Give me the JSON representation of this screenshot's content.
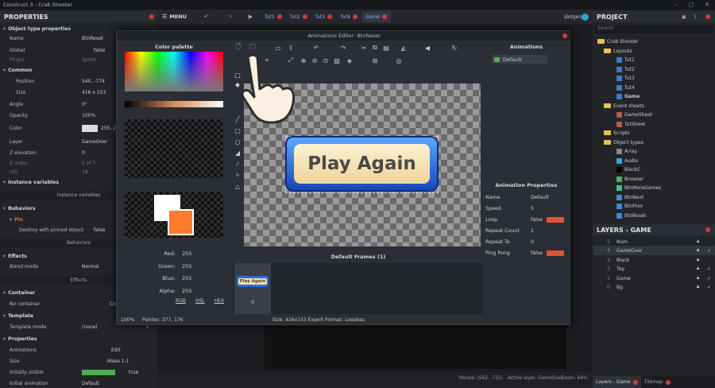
{
  "app": {
    "title": "Construct 3 - Crab Shooter"
  },
  "properties": {
    "title": "PROPERTIES",
    "sections": {
      "object_type": "Object type properties",
      "common": "Common",
      "instance_vars": "Instance variables",
      "behaviors": "Behaviors",
      "pin": "Pin",
      "effects": "Effects",
      "container": "Container",
      "template": "Template",
      "props": "Properties"
    },
    "rows": {
      "name_k": "Name",
      "name_v": "BtnReset",
      "global_k": "Global",
      "global_v": "false",
      "plugin_k": "Plugin",
      "plugin_v": "Sprite",
      "pos_k": "Position",
      "pos_v": "540, -774",
      "size_k": "Size",
      "size_v": "416 x 153",
      "angle_k": "Angle",
      "angle_v": "0°",
      "opacity_k": "Opacity",
      "opacity_v": "100%",
      "color_k": "Color",
      "color_v": "255, 2",
      "layer_k": "Layer",
      "layer_v": "GameOver",
      "zel_k": "Z elevation",
      "zel_v": "0",
      "zidx_k": "Z index",
      "zidx_v": "1 of 7",
      "uid_k": "UID",
      "uid_v": "18",
      "pin_k": "Destroy with pinned object",
      "pin_v": "false",
      "blend_k": "Blend mode",
      "blend_v": "Normal",
      "cont_k": "No container",
      "cont_v": "Cre",
      "tmpl_k": "Template mode",
      "tmpl_v": "(none)",
      "anim_k": "Animations",
      "anim_v": "Edit",
      "size2_k": "Size",
      "size2_v": "Make 1:1",
      "vis_k": "Initially visible",
      "vis_v": "true",
      "ianim_k": "Initial animation",
      "ianim_v": "Default"
    },
    "buttons": {
      "instance_vars": "Instance variables",
      "behaviors": "Behaviors",
      "effects": "Effects"
    }
  },
  "menu": {
    "label": "MENU",
    "tabs": [
      "Tut1",
      "Tut2",
      "Tut3",
      "Tut4",
      "Game"
    ],
    "user": "slotgen"
  },
  "project": {
    "title": "PROJECT",
    "search_placeholder": "Search",
    "items": [
      "Crab Shooter",
      "Layouts",
      "Tut1",
      "Tut2",
      "Tut3",
      "Tut4",
      "Game",
      "Event sheets",
      "GameSheet",
      "TutSheet",
      "Scripts",
      "Object types",
      "Array",
      "Audio",
      "BlackC",
      "Browser",
      "BtnMoreGames",
      "BtnNext",
      "BtnPrev",
      "BtnReset"
    ]
  },
  "layers": {
    "title": "LAYERS - GAME",
    "rows": [
      {
        "n": "5",
        "name": "Num"
      },
      {
        "n": "4",
        "name": "GameOver"
      },
      {
        "n": "3",
        "name": "Black"
      },
      {
        "n": "2",
        "name": "Top"
      },
      {
        "n": "1",
        "name": "Game"
      },
      {
        "n": "0",
        "name": "Bg"
      }
    ],
    "tab1": "Layers - Game",
    "tab2": "Tilemap"
  },
  "dialog": {
    "title": "Animations Editor: BtnReset",
    "palette_title": "Color palette",
    "animations_title": "Animations",
    "anim_item": "Default",
    "frames_title": "Default Frames (1)",
    "frame_index": "0",
    "zoom": "100%",
    "pointer": "Pointer: 377, 176",
    "size_info": "Size: 416x153   Export Format: Lossless",
    "button_text": "Play Again",
    "rgb": {
      "red_k": "Red:",
      "red_v": "255",
      "green_k": "Green:",
      "green_v": "255",
      "blue_k": "Blue:",
      "blue_v": "255",
      "alpha_k": "Alpha:",
      "alpha_v": "255",
      "modes": [
        "RGB",
        "HSL",
        "HEX"
      ]
    },
    "anim_props": {
      "title": "Animation Properties",
      "name_k": "Name",
      "name_v": "Default",
      "speed_k": "Speed",
      "speed_v": "5",
      "loop_k": "Loop",
      "loop_v": "false",
      "rc_k": "Repeat Count",
      "rc_v": "1",
      "rt_k": "Repeat To",
      "rt_v": "0",
      "pp_k": "Ping Pong",
      "pp_v": "false"
    }
  },
  "status": {
    "mouse": "Mouse: (562, -732)",
    "active_layer": "Active layer: GameOver",
    "zoom": "Zoom: 64%"
  },
  "colors": {
    "accent_red": "#d8383b",
    "palette_swatch": "#ff7a2f",
    "anim_green": "#4caf50"
  }
}
